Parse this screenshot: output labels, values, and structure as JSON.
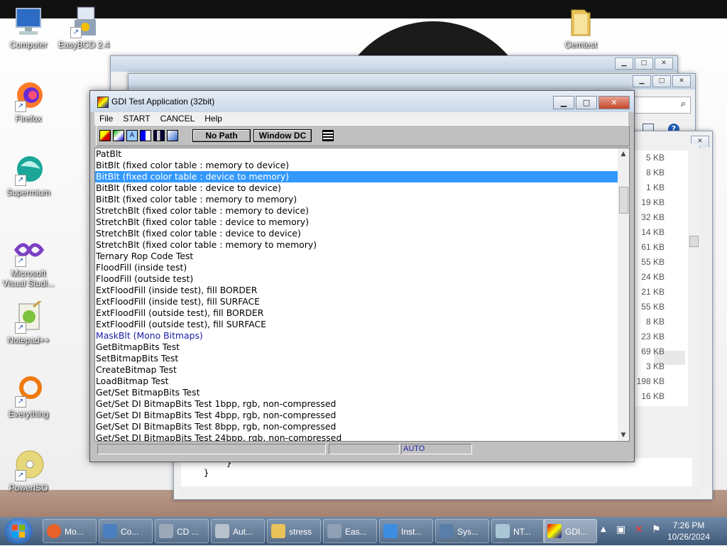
{
  "desktop": {
    "icons": [
      {
        "label": "Computer"
      },
      {
        "label": "EasyBCD 2.4"
      },
      {
        "label": "Oemtest"
      },
      {
        "label": "Firefox"
      },
      {
        "label": "Supermium"
      },
      {
        "label": "Microsoft Visual Studi..."
      },
      {
        "label": "Notepad++"
      },
      {
        "label": "Everything"
      },
      {
        "label": "PowerISO"
      }
    ]
  },
  "explorer_sizes": [
    "5 KB",
    "8 KB",
    "1 KB",
    "19 KB",
    "32 KB",
    "14 KB",
    "61 KB",
    "55 KB",
    "24 KB",
    "21 KB",
    "55 KB",
    "8 KB",
    "23 KB",
    "69 KB",
    "3 KB",
    "198 KB",
    "16 KB"
  ],
  "code_lines": [
    "}",
    "}"
  ],
  "gdi": {
    "title": "GDI Test Application (32bit)",
    "menu": [
      "File",
      "START",
      "CANCEL",
      "Help"
    ],
    "toolbar": {
      "no_path": "No Path",
      "window_dc": "Window DC"
    },
    "tests": [
      "PatBlt",
      "BitBlt (fixed color table : memory to device)",
      "BitBlt (fixed color table : device to memory)",
      "BitBlt (fixed color table : device to device)",
      "BitBlt (fixed color table : memory to memory)",
      "StretchBlt (fixed color table : memory to device)",
      "StretchBlt (fixed color table : device to memory)",
      "StretchBlt (fixed color table : device to device)",
      "StretchBlt (fixed color table : memory to memory)",
      "Ternary Rop Code Test",
      "FloodFill (inside test)",
      "FloodFill (outside test)",
      "ExtFloodFill (inside test), fill BORDER",
      "ExtFloodFill (inside test), fill SURFACE",
      "ExtFloodFill (outside test), fill BORDER",
      "ExtFloodFill (outside test), fill SURFACE",
      "MaskBlt (Mono Bitmaps)",
      "GetBitmapBits Test",
      "SetBitmapBits Test",
      "CreateBitmap Test",
      "LoadBitmap Test",
      "Get/Set BitmapBits Test",
      "Get/Set DI BitmapBits Test  1bpp, rgb, non-compressed",
      "Get/Set DI BitmapBits Test  4bpp, rgb, non-compressed",
      "Get/Set DI BitmapBits Test  8bpp, rgb, non-compressed",
      "Get/Set DI BitmapBits Test 24bpp, rgb, non-compressed"
    ],
    "selected_test": "BitBlt (fixed color table : device to memory)",
    "status": {
      "mode": "AUTO"
    }
  },
  "taskbar": {
    "tasks": [
      {
        "label": "Mo...",
        "icon": "firefox-icon",
        "color": "#e8622a"
      },
      {
        "label": "Co...",
        "icon": "computer-icon",
        "color": "#4a7fc0"
      },
      {
        "label": "CD ...",
        "icon": "cd-drive-icon",
        "color": "#9aa8b8"
      },
      {
        "label": "Aut...",
        "icon": "drive-icon",
        "color": "#b8c2cc"
      },
      {
        "label": "stress",
        "icon": "folder-icon",
        "color": "#e9c25a"
      },
      {
        "label": "Eas...",
        "icon": "easybcd-icon",
        "color": "#8fa0b4"
      },
      {
        "label": "Inst...",
        "icon": "windows-logo-icon",
        "color": "#3d8ee0"
      },
      {
        "label": "Sys...",
        "icon": "system-icon",
        "color": "#5a7ea8"
      },
      {
        "label": "NT...",
        "icon": "notepad-icon",
        "color": "#a9c6d6"
      },
      {
        "label": "GDI...",
        "icon": "gdi-app-icon",
        "color": "#c0c0c0"
      }
    ],
    "time": "7:26 PM",
    "date": "10/26/2024"
  }
}
